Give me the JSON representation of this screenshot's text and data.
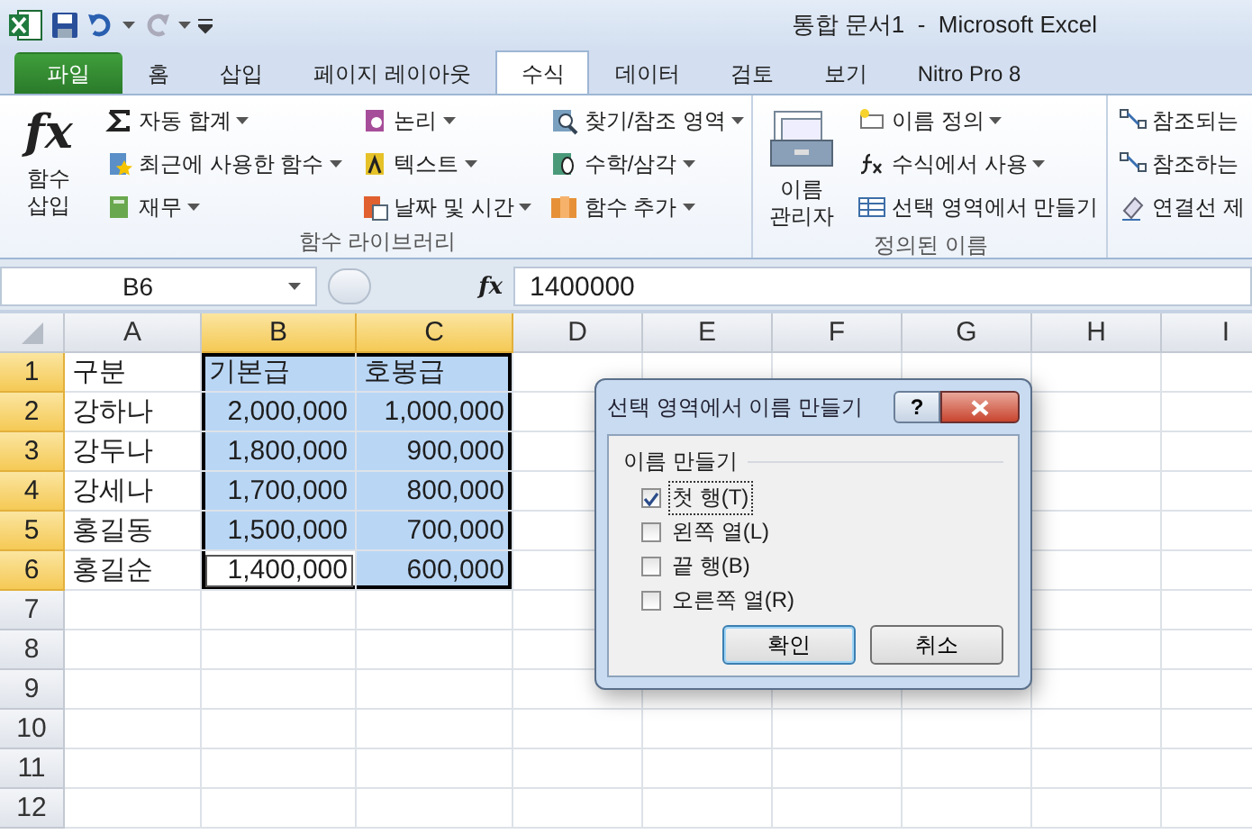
{
  "quick_access": {
    "title": "통합 문서1  -  Microsoft Excel"
  },
  "tabs": [
    {
      "label": "파일",
      "kind": "file",
      "selected": false
    },
    {
      "label": "홈",
      "kind": "normal",
      "selected": false
    },
    {
      "label": "삽입",
      "kind": "normal",
      "selected": false
    },
    {
      "label": "페이지 레이아웃",
      "kind": "normal",
      "selected": false
    },
    {
      "label": "수식",
      "kind": "normal",
      "selected": true
    },
    {
      "label": "데이터",
      "kind": "normal",
      "selected": false
    },
    {
      "label": "검토",
      "kind": "normal",
      "selected": false
    },
    {
      "label": "보기",
      "kind": "normal",
      "selected": false
    },
    {
      "label": "Nitro Pro 8",
      "kind": "normal",
      "selected": false
    }
  ],
  "ribbon": {
    "groups": [
      {
        "label": "함수 라이브러리",
        "large_button": {
          "label": "함수 삽입",
          "symbol": "fx"
        },
        "columns": [
          [
            {
              "label": "자동 합계",
              "dropdown": true
            },
            {
              "label": "최근에 사용한 함수",
              "dropdown": true
            },
            {
              "label": "재무",
              "dropdown": true
            }
          ],
          [
            {
              "label": "논리",
              "dropdown": true
            },
            {
              "label": "텍스트",
              "dropdown": true
            },
            {
              "label": "날짜 및 시간",
              "dropdown": true
            }
          ],
          [
            {
              "label": "찾기/참조 영역",
              "dropdown": true
            },
            {
              "label": "수학/삼각",
              "dropdown": true
            },
            {
              "label": "함수 추가",
              "dropdown": true
            }
          ]
        ]
      },
      {
        "label": "정의된 이름",
        "large_button": {
          "label": "이름 관리자"
        },
        "columns": [
          [
            {
              "label": "이름 정의",
              "dropdown": true
            },
            {
              "label": "수식에서 사용",
              "dropdown": true
            },
            {
              "label": "선택 영역에서 만들기",
              "dropdown": false
            }
          ]
        ]
      },
      {
        "columns": [
          [
            {
              "label": "참조되는",
              "dropdown": false
            },
            {
              "label": "참조하는",
              "dropdown": false
            },
            {
              "label": "연결선 제",
              "dropdown": false
            }
          ]
        ]
      }
    ]
  },
  "formula_bar": {
    "name_box": "B6",
    "fx_symbol": "fx",
    "value": "1400000"
  },
  "sheet": {
    "columns": [
      {
        "label": "A",
        "selected": false
      },
      {
        "label": "B",
        "selected": true
      },
      {
        "label": "C",
        "selected": true
      },
      {
        "label": "D",
        "selected": false
      },
      {
        "label": "E",
        "selected": false
      },
      {
        "label": "F",
        "selected": false
      },
      {
        "label": "G",
        "selected": false
      },
      {
        "label": "H",
        "selected": false
      },
      {
        "label": "I",
        "selected": false
      }
    ],
    "rows": [
      {
        "header": "1",
        "selected": true,
        "cells": [
          {
            "text": "구분",
            "kind": "text",
            "selected": false,
            "active": false
          },
          {
            "text": "기본급",
            "kind": "text",
            "selected": true,
            "active": false
          },
          {
            "text": "호봉급",
            "kind": "text",
            "selected": true,
            "active": false
          }
        ]
      },
      {
        "header": "2",
        "selected": true,
        "cells": [
          {
            "text": "강하나",
            "kind": "text",
            "selected": false,
            "active": false
          },
          {
            "text": "2,000,000",
            "kind": "number",
            "selected": true,
            "active": false
          },
          {
            "text": "1,000,000",
            "kind": "number",
            "selected": true,
            "active": false
          }
        ]
      },
      {
        "header": "3",
        "selected": true,
        "cells": [
          {
            "text": "강두나",
            "kind": "text",
            "selected": false,
            "active": false
          },
          {
            "text": "1,800,000",
            "kind": "number",
            "selected": true,
            "active": false
          },
          {
            "text": "900,000",
            "kind": "number",
            "selected": true,
            "active": false
          }
        ]
      },
      {
        "header": "4",
        "selected": true,
        "cells": [
          {
            "text": "강세나",
            "kind": "text",
            "selected": false,
            "active": false
          },
          {
            "text": "1,700,000",
            "kind": "number",
            "selected": true,
            "active": false
          },
          {
            "text": "800,000",
            "kind": "number",
            "selected": true,
            "active": false
          }
        ]
      },
      {
        "header": "5",
        "selected": true,
        "cells": [
          {
            "text": "홍길동",
            "kind": "text",
            "selected": false,
            "active": false
          },
          {
            "text": "1,500,000",
            "kind": "number",
            "selected": true,
            "active": false
          },
          {
            "text": "700,000",
            "kind": "number",
            "selected": true,
            "active": false
          }
        ]
      },
      {
        "header": "6",
        "selected": true,
        "cells": [
          {
            "text": "홍길순",
            "kind": "text",
            "selected": false,
            "active": false
          },
          {
            "text": "1,400,000",
            "kind": "number",
            "selected": true,
            "active": true
          },
          {
            "text": "600,000",
            "kind": "number",
            "selected": true,
            "active": false
          }
        ]
      },
      {
        "header": "7",
        "selected": false,
        "cells": []
      },
      {
        "header": "8",
        "selected": false,
        "cells": []
      },
      {
        "header": "9",
        "selected": false,
        "cells": []
      },
      {
        "header": "10",
        "selected": false,
        "cells": []
      },
      {
        "header": "11",
        "selected": false,
        "cells": []
      },
      {
        "header": "12",
        "selected": false,
        "cells": []
      }
    ]
  },
  "dialog": {
    "title": "선택 영역에서 이름 만들기",
    "help": "?",
    "group_label": "이름 만들기",
    "options": [
      {
        "label": "첫 행(T)",
        "checked": true,
        "focused": true
      },
      {
        "label": "왼쪽 열(L)",
        "checked": false,
        "focused": false
      },
      {
        "label": "끝 행(B)",
        "checked": false,
        "focused": false
      },
      {
        "label": "오른쪽 열(R)",
        "checked": false,
        "focused": false
      }
    ],
    "buttons": [
      {
        "label": "확인",
        "kind": "default"
      },
      {
        "label": "취소",
        "kind": "normal"
      }
    ]
  }
}
